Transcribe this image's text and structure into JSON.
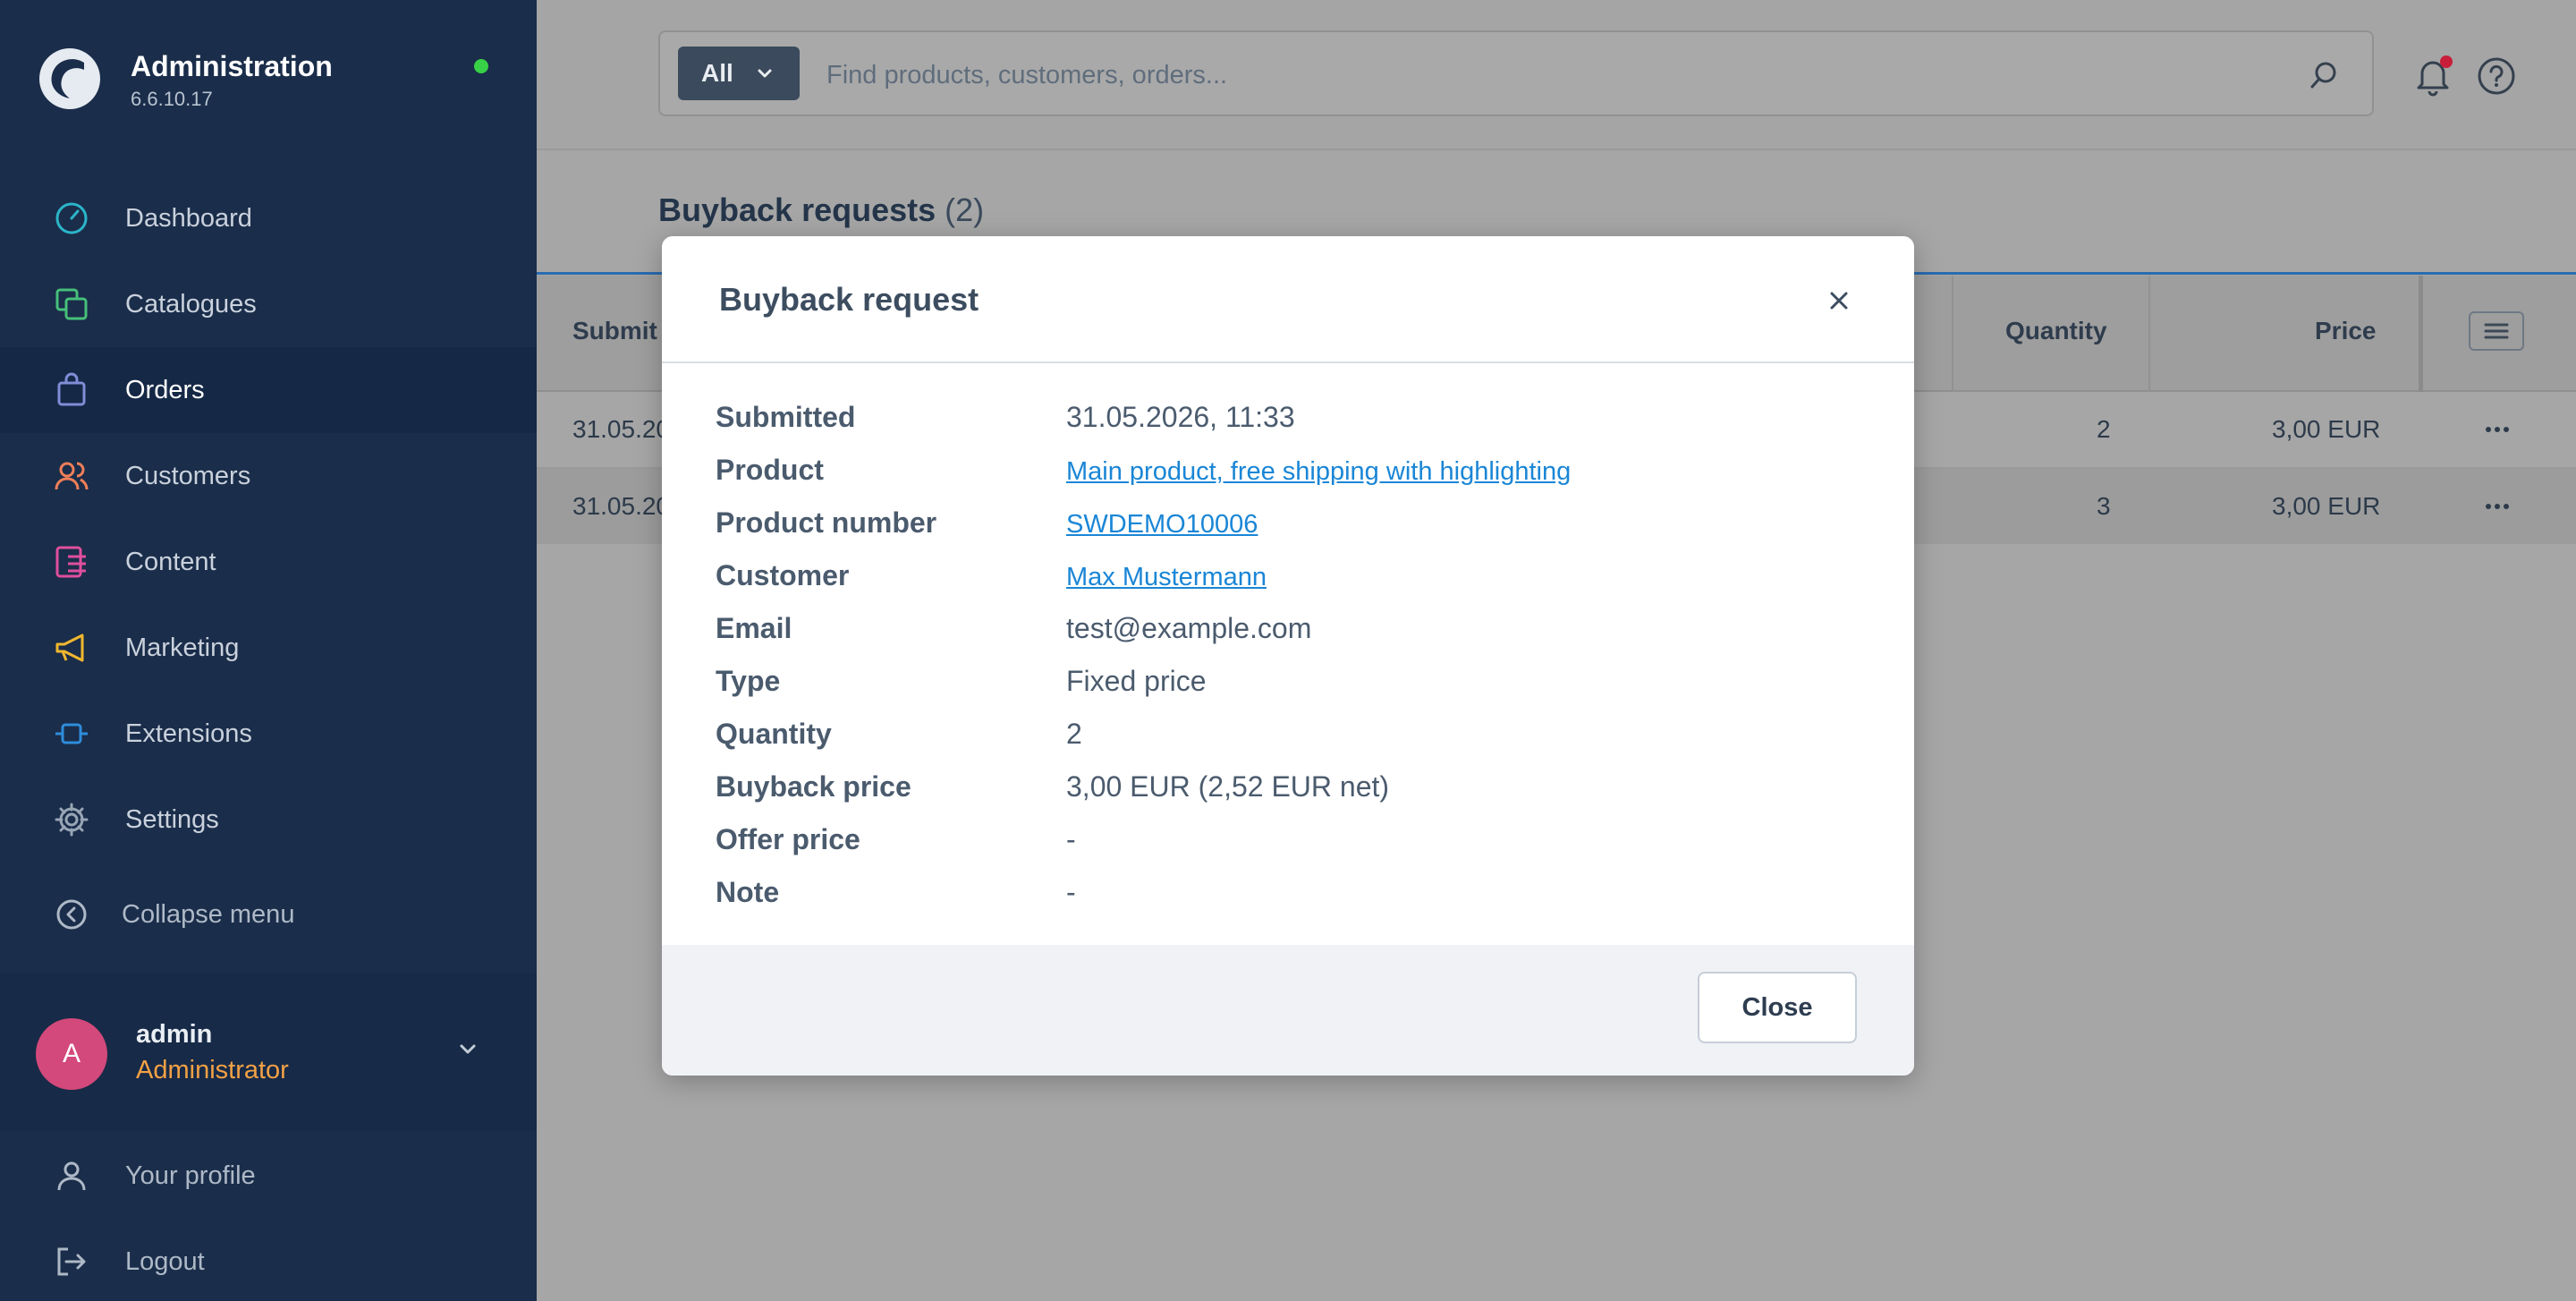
{
  "app": {
    "title": "Administration",
    "version": "6.6.10.17",
    "status_color": "#37d046"
  },
  "sidebar": {
    "items": [
      {
        "label": "Dashboard",
        "icon": "dashboard-icon",
        "color": "#2bb5c9"
      },
      {
        "label": "Catalogues",
        "icon": "catalogue-icon",
        "color": "#46c07a"
      },
      {
        "label": "Orders",
        "icon": "orders-bag-icon",
        "color": "#7f8ed6",
        "active": true
      },
      {
        "label": "Customers",
        "icon": "customers-icon",
        "color": "#f07f58"
      },
      {
        "label": "Content",
        "icon": "content-icon",
        "color": "#e04f9e"
      },
      {
        "label": "Marketing",
        "icon": "marketing-megaphone-icon",
        "color": "#f0b72e"
      },
      {
        "label": "Extensions",
        "icon": "extensions-plug-icon",
        "color": "#2f8ddb"
      },
      {
        "label": "Settings",
        "icon": "settings-gear-icon",
        "color": "#98a5b5"
      }
    ],
    "collapse_label": "Collapse menu",
    "user": {
      "initial": "A",
      "name": "admin",
      "role": "Administrator"
    },
    "profile_links": [
      {
        "label": "Your profile",
        "icon": "user-icon"
      },
      {
        "label": "Logout",
        "icon": "logout-icon"
      }
    ]
  },
  "topbar": {
    "search_type": "All",
    "search_placeholder": "Find products, customers, orders..."
  },
  "page": {
    "title": "Buyback requests",
    "count": "(2)"
  },
  "grid": {
    "columns": [
      "Submitted",
      "Quantity",
      "Price"
    ],
    "visible_submitted_header": "Submit",
    "rows": [
      {
        "submitted": "31.05.20",
        "quantity": "2",
        "price": "3,00 EUR"
      },
      {
        "submitted": "31.05.20",
        "quantity": "3",
        "price": "3,00 EUR"
      }
    ]
  },
  "modal": {
    "title": "Buyback request",
    "details": [
      {
        "label": "Submitted",
        "value": "31.05.2026, 11:33",
        "link": false
      },
      {
        "label": "Product",
        "value": "Main product, free shipping with highlighting",
        "link": true
      },
      {
        "label": "Product number",
        "value": "SWDEMO10006",
        "link": true
      },
      {
        "label": "Customer",
        "value": "Max Mustermann",
        "link": true
      },
      {
        "label": "Email",
        "value": "test@example.com",
        "link": false
      },
      {
        "label": "Type",
        "value": "Fixed price",
        "link": false
      },
      {
        "label": "Quantity",
        "value": "2",
        "link": false
      },
      {
        "label": "Buyback price",
        "value": "3,00 EUR (2,52 EUR net)",
        "link": false
      },
      {
        "label": "Offer price",
        "value": "-",
        "link": false
      },
      {
        "label": "Note",
        "value": "-",
        "link": false
      }
    ],
    "close_label": "Close"
  }
}
